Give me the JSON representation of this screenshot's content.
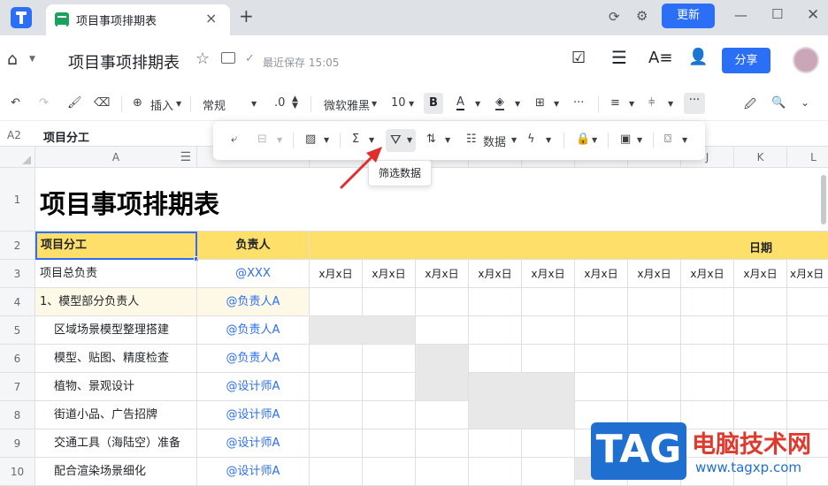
{
  "tabbar": {
    "tab_title": "项目事项排期表",
    "update_label": "更新"
  },
  "header": {
    "doc_title": "项目事项排期表",
    "save_status": "最近保存 15:05",
    "share_label": "分享"
  },
  "toolbar": {
    "insert_label": "插入",
    "format_label": "常规",
    "decimal_label": ".0",
    "font_label": "微软雅黑",
    "font_size": "10",
    "bold_label": "B",
    "text_color_label": "A",
    "more_label": "···"
  },
  "formulabar": {
    "cell_ref": "A2",
    "content": "项目分工"
  },
  "float_toolbar": {
    "data_label": "数据",
    "tooltip": "筛选数据"
  },
  "columns": [
    "A",
    "J",
    "K",
    "L"
  ],
  "rows": [
    {
      "num": "1",
      "a": "项目事项排期表",
      "b": ""
    },
    {
      "num": "2",
      "a": "项目分工",
      "b": "负责人",
      "date_header": "日期"
    },
    {
      "num": "3",
      "a": "项目总负责",
      "b": "@XXX"
    },
    {
      "num": "4",
      "a": "1、模型部分负责人",
      "b": "@负责人A"
    },
    {
      "num": "5",
      "a": "区域场景模型整理搭建",
      "b": "@负责人A"
    },
    {
      "num": "6",
      "a": "模型、贴图、精度检查",
      "b": "@负责人A"
    },
    {
      "num": "7",
      "a": "植物、景观设计",
      "b": "@设计师A"
    },
    {
      "num": "8",
      "a": "街道小品、广告招牌",
      "b": "@设计师A"
    },
    {
      "num": "9",
      "a": "交通工具（海陆空）准备",
      "b": "@设计师A"
    },
    {
      "num": "10",
      "a": "配合渲染场景细化",
      "b": "@设计师A"
    }
  ],
  "date_cells": [
    "x月x日",
    "x月x日",
    "x月x日",
    "x月x日",
    "x月x日",
    "x月x日",
    "x月x日",
    "x月x日",
    "x月x日",
    "x月x日"
  ],
  "watermark": {
    "tag": "TAG",
    "site_name": "电脑技术网",
    "url": "www.tagxp.com"
  },
  "colors": {
    "accent": "#2b6ff6",
    "header_yellow": "#fedf6a",
    "row4_bg": "#fef9e6",
    "shaded": "#e8e8e8"
  }
}
